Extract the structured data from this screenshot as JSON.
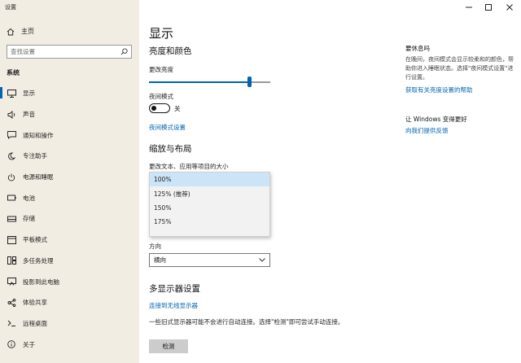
{
  "window": {
    "title": "设置"
  },
  "sidebar": {
    "home_label": "主页",
    "search_placeholder": "查找设置",
    "section": "系统",
    "items": [
      {
        "label": "显示",
        "icon": "monitor-icon"
      },
      {
        "label": "声音",
        "icon": "speaker-icon"
      },
      {
        "label": "通知和操作",
        "icon": "message-icon"
      },
      {
        "label": "专注助手",
        "icon": "moon-icon"
      },
      {
        "label": "电源和睡眠",
        "icon": "power-icon"
      },
      {
        "label": "电池",
        "icon": "battery-icon"
      },
      {
        "label": "存储",
        "icon": "storage-icon"
      },
      {
        "label": "平板模式",
        "icon": "tablet-icon"
      },
      {
        "label": "多任务处理",
        "icon": "multitask-icon"
      },
      {
        "label": "投影到此电脑",
        "icon": "project-icon"
      },
      {
        "label": "体验共享",
        "icon": "share-icon"
      },
      {
        "label": "远程桌面",
        "icon": "remote-icon"
      },
      {
        "label": "关于",
        "icon": "info-icon"
      }
    ]
  },
  "main": {
    "title": "显示",
    "brightness_heading": "亮度和颜色",
    "brightness_label": "更改亮度",
    "brightness_value": 0.83,
    "night_light_label": "夜间模式",
    "night_light_state": "关",
    "night_light_link": "夜间模式设置",
    "scale_heading": "缩放与布局",
    "scale_label": "更改文本、应用等项目的大小",
    "scale_options": [
      "100%",
      "125% (推荐)",
      "150%",
      "175%"
    ],
    "scale_selected_index": 0,
    "orientation_label": "方向",
    "orientation_value": "横向",
    "multi_heading": "多显示器设置",
    "wireless_link": "连接到无线显示器",
    "multi_desc": "一些旧式显示器可能不会进行自动连接。选择\"检测\"即可尝试手动连接。",
    "detect_button": "检测"
  },
  "right_panel": {
    "title": "要休息吗",
    "text": "在晚间，夜间模式会显示较柔和的颜色，帮助你进入睡眠状态。选择\"夜间模式设置\"进行设置。",
    "link": "获取有关亮度设置的帮助",
    "improve_title": "让 Windows 变得更好",
    "feedback_link": "向我们提供反馈"
  },
  "colors": {
    "accent": "#0063b1",
    "sidebar_bg": "#f2ede3",
    "selected_option": "#cce4f7"
  }
}
